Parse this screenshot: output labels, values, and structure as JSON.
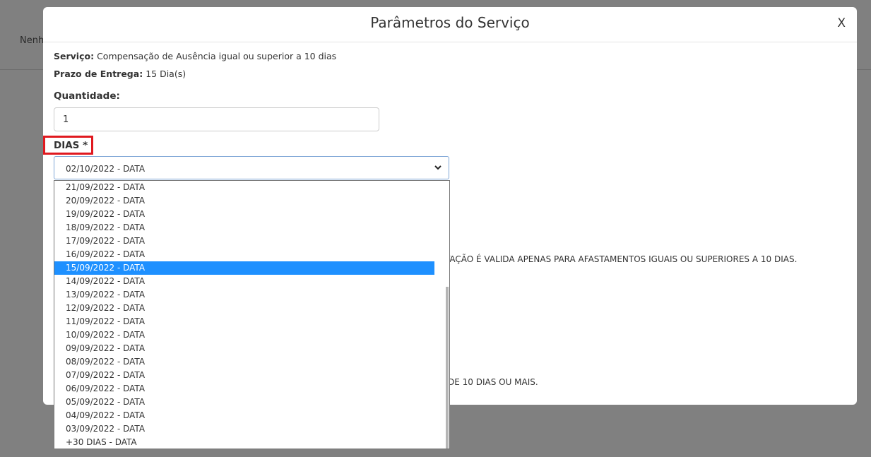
{
  "background": {
    "truncated_text": "Nenh"
  },
  "modal": {
    "title": "Parâmetros do Serviço",
    "close_label": "X",
    "servico_label": "Serviço:",
    "servico_value": "Compensação de Ausência igual ou superior a 10 dias",
    "prazo_label": "Prazo de Entrega:",
    "prazo_value": "15 Dia(s)",
    "quantidade_label": "Quantidade:",
    "quantidade_value": "1",
    "dias_label": "DIAS *",
    "dias_selected": "02/10/2022 - DATA",
    "notice_1": "TAÇÃO É VALIDA APENAS PARA AFASTAMENTOS IGUAIS OU SUPERIORES A 10 DIAS.",
    "notice_2": "DE 10 DIAS OU MAIS."
  },
  "dropdown": {
    "options": [
      "21/09/2022 - DATA",
      "20/09/2022 - DATA",
      "19/09/2022 - DATA",
      "18/09/2022 - DATA",
      "17/09/2022 - DATA",
      "16/09/2022 - DATA",
      "15/09/2022 - DATA",
      "14/09/2022 - DATA",
      "13/09/2022 - DATA",
      "12/09/2022 - DATA",
      "11/09/2022 - DATA",
      "10/09/2022 - DATA",
      "09/09/2022 - DATA",
      "08/09/2022 - DATA",
      "07/09/2022 - DATA",
      "06/09/2022 - DATA",
      "05/09/2022 - DATA",
      "04/09/2022 - DATA",
      "03/09/2022 - DATA",
      "+30 DIAS - DATA"
    ],
    "highlighted_option": "15/09/2022 - DATA"
  },
  "colors": {
    "overlay": "#808080",
    "highlight_box": "#e0191f",
    "option_selected_bg": "#1e90ff"
  }
}
